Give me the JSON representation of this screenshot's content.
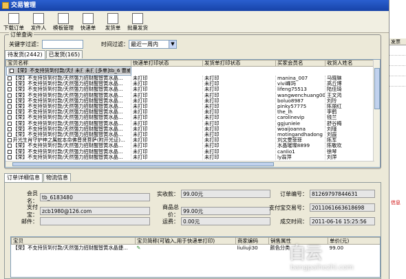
{
  "title": "交易管理",
  "toolbar": [
    "下载订单",
    "发件人",
    "模板管理",
    "快递单",
    "发货单",
    "批量发货"
  ],
  "query": {
    "legend": "订单查询",
    "keyword_label": "关键字过滤：",
    "keyword_value": "",
    "time_label": "时间过滤：",
    "time_value": "最近一周内"
  },
  "tabs": [
    "待发货(2442)",
    "已发货(165)"
  ],
  "grid": {
    "columns": [
      "宝贝名称",
      "快递单打印状态",
      "发货单打印状态",
      "买家会员名",
      "收货人姓名"
    ],
    "rows": [
      [
        "【荣】不支持货到付款/天然强力招财醒智黄水晶...",
        "未打印",
        "未打印",
        "[多单]tb_6183480",
        "曹威翔"
      ],
      [
        "【荣】不支持货到付款/天然强力招财醒智黄水晶...",
        "未打印",
        "未打印",
        "manina_007",
        "马晓琳"
      ],
      [
        "【荣】不支持货到付款/天然强力招财醒智黄水晶...",
        "未打印",
        "未打印",
        "vivi峰玛",
        "高丘博"
      ],
      [
        "【荣】不支持货到付款/天然强力招财醒智黄水晶...",
        "未打印",
        "未打印",
        "lifeng75513",
        "陆佳琦"
      ],
      [
        "【荣】不支持货到付款/天然强力招财醒智黄水晶...",
        "未打印",
        "未打印",
        "wangwenchuang008",
        "王文鸿"
      ],
      [
        "【荣】不支持货到付款/天然强力招财醒智黄水晶...",
        "未打印",
        "未打印",
        "boluo8987",
        "刘玲"
      ],
      [
        "【荣】不支持货到付款/天然强力招财醒智黄水晶...",
        "未打印",
        "未打印",
        "pinky57775",
        "陈丽红"
      ],
      [
        "【荣】不支持货到付款/天然强力招财醒智黄水晶...",
        "未打印",
        "未打印",
        "the_lh",
        "李鹤"
      ],
      [
        "【荣】不支持货到付款/天然强力招财醒智黄水晶...",
        "未打印",
        "未打印",
        "carolinevip",
        "钱兰"
      ],
      [
        "【荣】不支持货到付款/天然强力招财醒智黄水晶...",
        "未打印",
        "未打印",
        "ggjunieie",
        "舒谷梅"
      ],
      [
        "【荣】不支持货到付款/天然强力招财醒智黄水晶...",
        "未打印",
        "未打印",
        "woaijoanna",
        "刘瑾"
      ],
      [
        "【荣】不支持货到付款/天然强力招财醒智黄水晶...",
        "未打印",
        "未打印",
        "motingandhadong",
        "刘霞"
      ],
      [
        "开光生肖守护神之属蛇本命佛普贤菩萨(附开光证)...",
        "未打印",
        "未打印",
        "刘文雯菲菲",
        "陈军"
      ],
      [
        "【荣】不支持货到付款/天然强力招财醒智黄水晶...",
        "未打印",
        "未打印",
        "水晶璀璨8899",
        "陈敏欢"
      ],
      [
        "【荣】不支持货到付款/天然强力招财醒智黄水晶...",
        "未打印",
        "未打印",
        "canlio1",
        "徐琴"
      ],
      [
        "【荣】不支持货到付款/天然强力招财醒智黄水晶...",
        "未打印",
        "未打印",
        "ly霖萍",
        "刘萍"
      ]
    ]
  },
  "detail_tabs": [
    "订单详细信息",
    "物流信息"
  ],
  "detail": {
    "member_label": "会员名：",
    "member_value": "tb_6183480",
    "paid_label": "实收款：",
    "paid_value": "99.00元",
    "order_no_label": "订单编号：",
    "order_no_value": "81269797844631",
    "alipay_label": "支付宝：",
    "alipay_value": "zcb1980@126.com",
    "total_label": "商品总价：",
    "total_value": "99.00元",
    "trade_no_label": "支付宝交易号：",
    "trade_no_value": "2011061663618698",
    "postcode_label": "邮件：",
    "postcode_value": "",
    "shipping_label": "运费：",
    "shipping_value": "0.00元",
    "deal_time_label": "成交时间：",
    "deal_time_value": "2011-06-16 15:25:56"
  },
  "items": {
    "columns": [
      "宝贝",
      "宝贝简称(可输入,用于快递单打印)",
      "商家编码",
      "销售属性",
      "单价(元)"
    ],
    "rows": [
      [
        "【荣】不支持货到付款/天然强力招财醒智黄水晶捷...",
        "",
        "liuliuji30",
        "颜色分类",
        "99.00"
      ]
    ]
  },
  "right_panel": {
    "header": "发票",
    "note": "信息"
  },
  "watermark": {
    "text": "白云",
    "url": "bangpaihezhi.com"
  }
}
